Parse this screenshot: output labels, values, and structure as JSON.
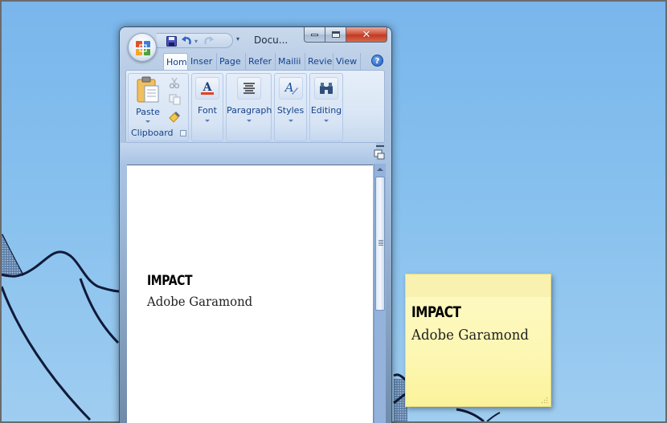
{
  "window": {
    "title": "Docu...",
    "caption_buttons": {
      "minimize": "minimize",
      "maximize": "maximize",
      "close": "close"
    }
  },
  "quick_access": {
    "items": [
      {
        "name": "save",
        "icon": "save-icon"
      },
      {
        "name": "undo",
        "icon": "undo-icon"
      },
      {
        "name": "undo-dropdown",
        "glyph": "▾"
      },
      {
        "name": "redo",
        "icon": "redo-icon"
      }
    ],
    "customize_glyph": "▾"
  },
  "ribbon": {
    "tabs": [
      {
        "label": "Home",
        "active": true
      },
      {
        "label": "Inser",
        "active": false
      },
      {
        "label": "Page",
        "active": false
      },
      {
        "label": "Refer",
        "active": false
      },
      {
        "label": "Mailii",
        "active": false
      },
      {
        "label": "Revie",
        "active": false
      },
      {
        "label": "View",
        "active": false
      }
    ],
    "help_glyph": "?",
    "groups": {
      "clipboard": {
        "label": "Clipboard",
        "paste_label": "Paste"
      },
      "font": {
        "label": "Font"
      },
      "paragraph": {
        "label": "Paragraph"
      },
      "styles": {
        "label": "Styles"
      },
      "editing": {
        "label": "Editing"
      }
    }
  },
  "document": {
    "line1": "IMPACT",
    "line2": "Adobe Garamond"
  },
  "sticky_note": {
    "line1": "IMPACT",
    "line2": "Adobe Garamond",
    "color": "#fdf7b4"
  },
  "colors": {
    "desktop": "#80bbee",
    "ribbon_text": "#15428b",
    "close_button": "#c23a20",
    "font_color_underline": "#e8401c"
  }
}
